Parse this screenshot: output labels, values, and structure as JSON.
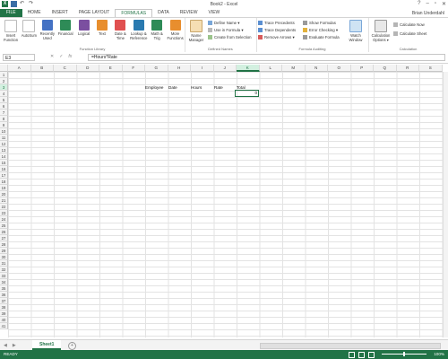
{
  "window": {
    "title": "Book2 - Excel",
    "minimize": "–",
    "restore": "▫",
    "close": "✕",
    "help": "?"
  },
  "tabs": [
    "FILE",
    "HOME",
    "INSERT",
    "PAGE LAYOUT",
    "FORMULAS",
    "DATA",
    "REVIEW",
    "VIEW"
  ],
  "active_tab": "FORMULAS",
  "user": "Brian Underdahl",
  "ribbon": {
    "function_library": {
      "label": "Function Library",
      "buttons": [
        {
          "line1": "Insert",
          "line2": "Function",
          "icon": "fx-icon",
          "color": "#ffffff"
        },
        {
          "line1": "AutoSum",
          "line2": "",
          "icon": "sigma-icon",
          "color": "#ffffff"
        },
        {
          "line1": "Recently",
          "line2": "Used",
          "icon": "star-icon",
          "color": "#4472c4"
        },
        {
          "line1": "Financial",
          "line2": "",
          "icon": "book-icon",
          "color": "#2e8b57"
        },
        {
          "line1": "Logical",
          "line2": "",
          "icon": "question-icon",
          "color": "#7b4fa0"
        },
        {
          "line1": "Text",
          "line2": "",
          "icon": "text-icon",
          "color": "#e88e2e"
        },
        {
          "line1": "Date &",
          "line2": "Time",
          "icon": "clock-icon",
          "color": "#e05050"
        },
        {
          "line1": "Lookup &",
          "line2": "Reference",
          "icon": "search-icon",
          "color": "#2a7ab0"
        },
        {
          "line1": "Math &",
          "line2": "Trig",
          "icon": "math-icon",
          "color": "#2e8b57"
        },
        {
          "line1": "More",
          "line2": "Functions",
          "icon": "more-icon",
          "color": "#e88e2e"
        }
      ]
    },
    "defined_names": {
      "label": "Defined Names",
      "name_manager": {
        "line1": "Name",
        "line2": "Manager"
      },
      "items": [
        "Define Name ▾",
        "Use in Formula ▾",
        "Create from Selection"
      ]
    },
    "formula_auditing": {
      "label": "Formula Auditing",
      "col1": [
        "Trace Precedents",
        "Trace Dependents",
        "Remove Arrows ▾"
      ],
      "col2": [
        "Show Formulas",
        "Error Checking ▾",
        "Evaluate Formula"
      ],
      "watch": {
        "line1": "Watch",
        "line2": "Window"
      }
    },
    "calculation": {
      "label": "Calculation",
      "options": {
        "line1": "Calculation",
        "line2": "Options ▾"
      },
      "items": [
        "Calculate Now",
        "Calculate Sheet"
      ]
    }
  },
  "formula_bar": {
    "name_box": "E3",
    "cancel": "✕",
    "enter": "✓",
    "fx": "fx",
    "formula": "=Hours*Rate"
  },
  "columns": [
    "A",
    "B",
    "C",
    "D",
    "E",
    "F",
    "G",
    "H",
    "I",
    "J",
    "K",
    "L",
    "M",
    "N",
    "O",
    "P",
    "Q",
    "R",
    "S"
  ],
  "active_column": "K",
  "active_row": 3,
  "rows": [
    1,
    2,
    3,
    4,
    5,
    6,
    7,
    8,
    9,
    10,
    11,
    12,
    13,
    14,
    15,
    16,
    17,
    18,
    19,
    20,
    21,
    22,
    23,
    24,
    25,
    26,
    27,
    28,
    29,
    30,
    31,
    32,
    33,
    34,
    35,
    36,
    37,
    38,
    39,
    40,
    41
  ],
  "cells": {
    "headers": [
      "Employee",
      "Date",
      "Hours",
      "Rate",
      "Total"
    ],
    "active_value": "0"
  },
  "sheet": {
    "name": "Sheet1",
    "add": "+"
  },
  "status": {
    "ready": "READY",
    "zoom": "100%"
  }
}
